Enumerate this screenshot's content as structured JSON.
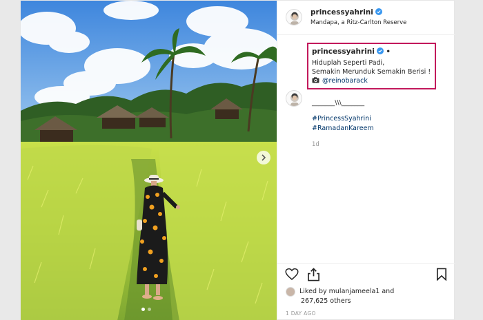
{
  "post": {
    "username": "princessyahrini",
    "location": "Mandapa, a Ritz-Carlton Reserve",
    "caption": {
      "username": "princessyahrini",
      "separator": "•",
      "line1": "Hiduplah Seperti Padi,",
      "line2": "Semakin Merunduk Semakin Berisi !",
      "credit_mention": "@reinobarack"
    },
    "comment": {
      "line": "_______\\\\\\_______",
      "hashtags": [
        "#PrincessSyahrini",
        "#RamadanKareem"
      ],
      "age": "1d"
    },
    "likes": {
      "line1": "Liked by mulanjameela1 and",
      "line2": "267,625 others"
    },
    "date": "1 DAY AGO",
    "carousel": {
      "slides": 2,
      "active": 0
    }
  },
  "icons": [
    "verified-badge-icon",
    "camera-icon",
    "heart-icon",
    "share-icon",
    "bookmark-icon",
    "chevron-right-icon"
  ],
  "colors": {
    "highlight_box": "#c2185b",
    "verified": "#3897f0",
    "link": "#003569"
  }
}
